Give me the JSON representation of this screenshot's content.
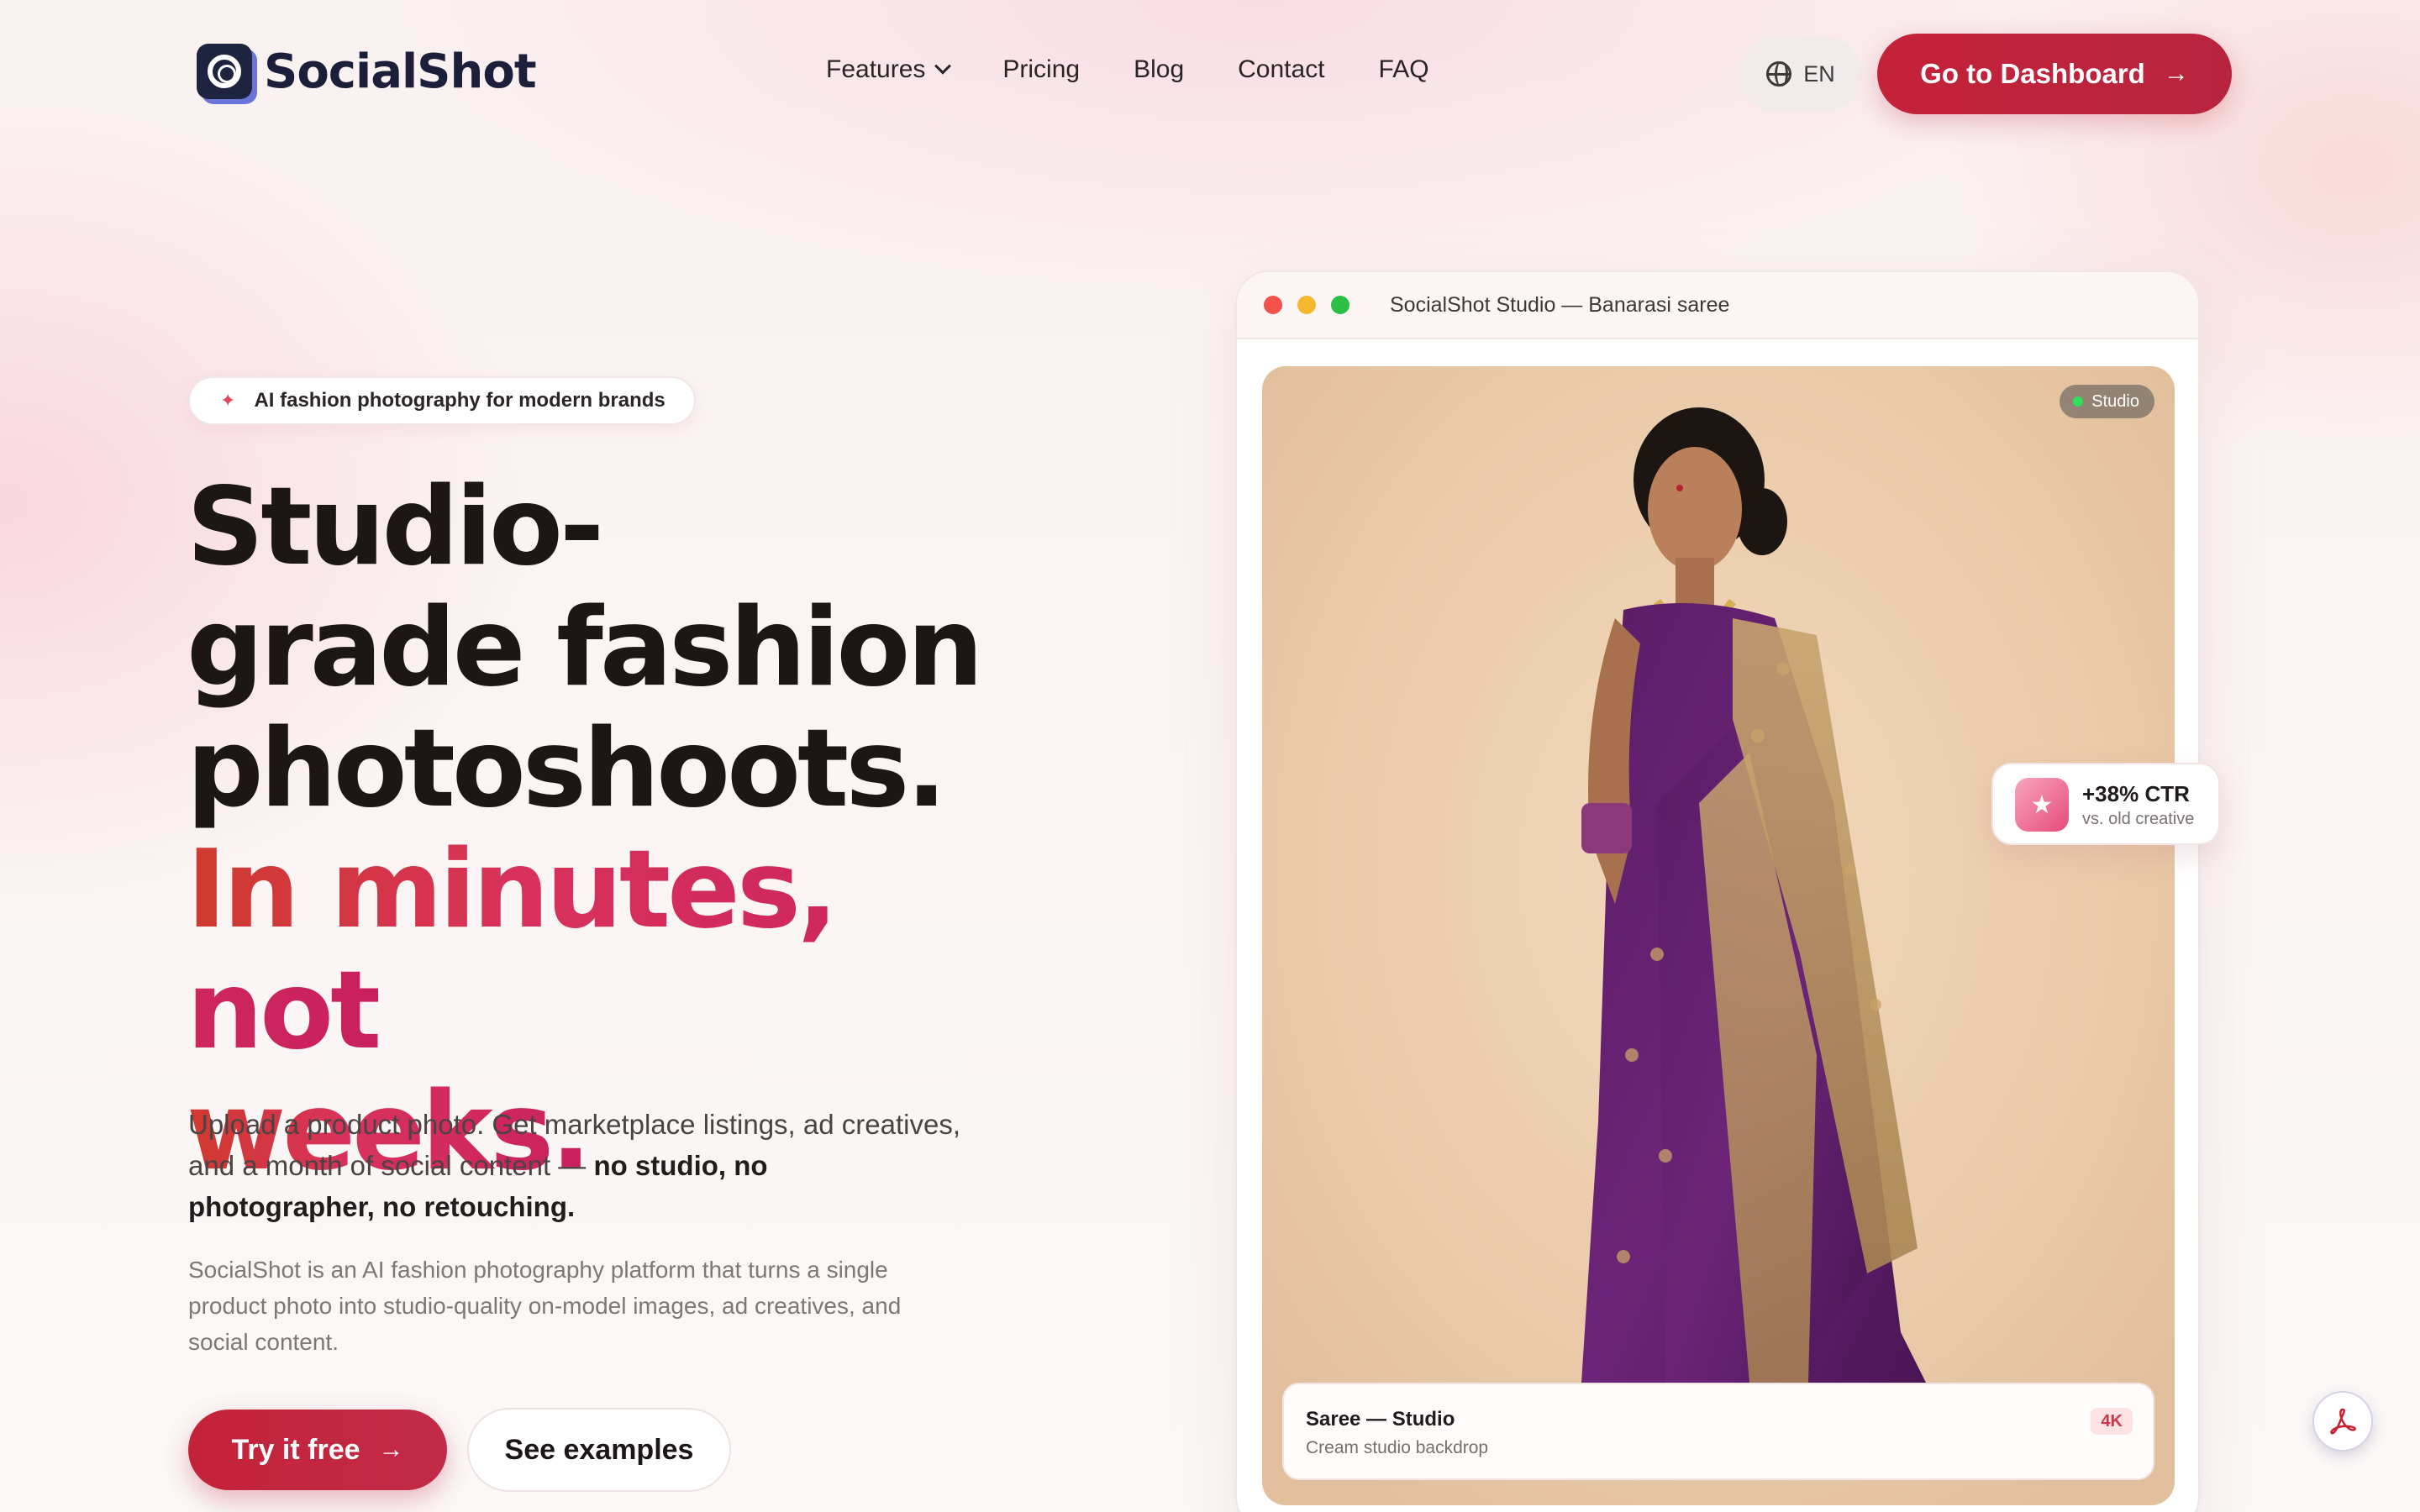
{
  "brand": {
    "name": "SocialShot"
  },
  "nav": {
    "items": [
      {
        "label": "Features",
        "has_dropdown": true
      },
      {
        "label": "Pricing"
      },
      {
        "label": "Blog"
      },
      {
        "label": "Contact"
      },
      {
        "label": "FAQ"
      }
    ],
    "language": "EN",
    "cta_label": "Go to Dashboard",
    "cta_arrow": "→"
  },
  "hero": {
    "badge": "AI fashion photography for modern brands",
    "headline_line1": "Studio-",
    "headline_line2": "grade fashion",
    "headline_line3": "photoshoots.",
    "headline_accent_line1": "In minutes, not",
    "headline_accent_line2": "weeks.",
    "lead_plain": "Upload a product photo. Get marketplace listings, ad creatives, and a month of social content — ",
    "lead_bold": "no studio, no photographer, no retouching.",
    "sub": "SocialShot is an AI fashion photography platform that turns a single product photo into studio-quality on-model images, ad creatives, and social content.",
    "primary_cta": "Try it free",
    "primary_arrow": "→",
    "secondary_cta": "See examples"
  },
  "preview": {
    "window_title": "SocialShot Studio — Banarasi saree",
    "tag": "Studio",
    "caption_title": "Saree — Studio",
    "caption_sub": "Cream studio backdrop",
    "caption_badge": "4K",
    "stat_value": "+38% CTR",
    "stat_label": "vs. old creative"
  },
  "colors": {
    "brand_red": "#c42239",
    "accent_pink": "#d8325c",
    "logo_navy": "#1b1f3a"
  },
  "icons": [
    "chevron-down-icon",
    "globe-icon",
    "arrow-right-icon",
    "sparkle-icon",
    "star-icon",
    "pdf-icon"
  ]
}
